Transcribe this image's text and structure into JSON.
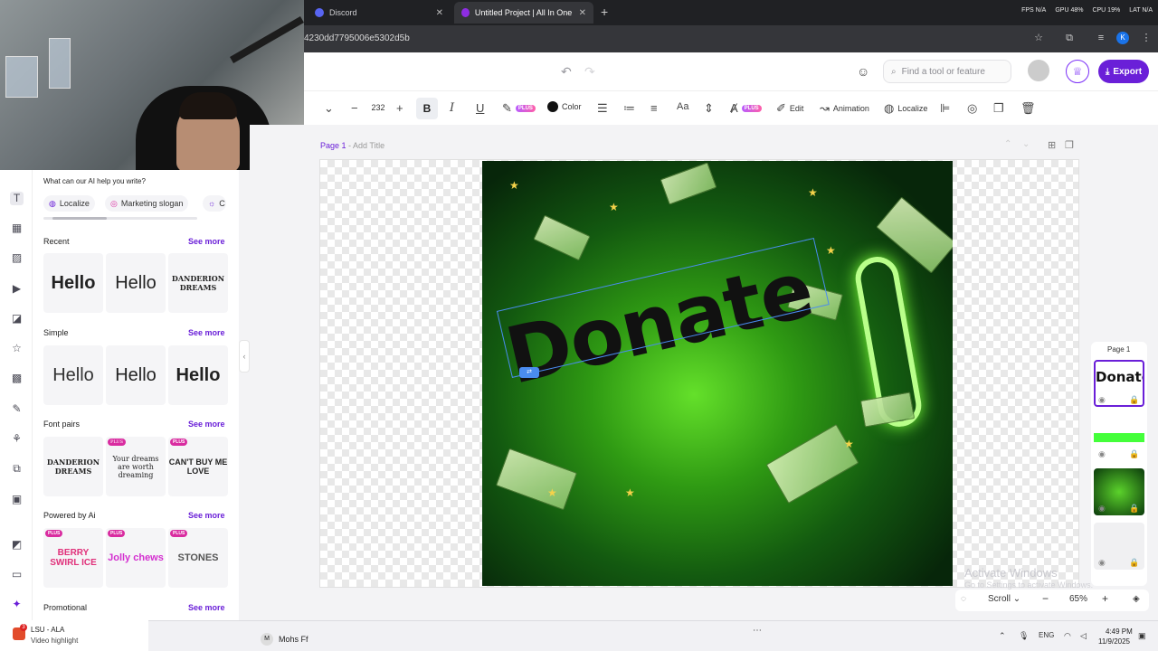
{
  "browser": {
    "tabs": [
      {
        "label": "Discord",
        "color": "#5865f2"
      },
      {
        "label": "Untitled Project | All In One We",
        "color": "#8e2de2"
      }
    ],
    "perf": [
      "FPS N/A",
      "GPU 48%",
      "CPU 19%",
      "LAT N/A"
    ],
    "url": "4230dd7795006e5302d5b",
    "profile_initial": "K"
  },
  "header": {
    "search_placeholder": "Find a tool or feature",
    "export_label": "Export"
  },
  "toolbar": {
    "font_size": "232",
    "color_label": "Color",
    "edit_label": "Edit",
    "animation_label": "Animation",
    "localize_label": "Localize",
    "plus_badge": "PLUS"
  },
  "panel": {
    "ai_prompt": "What can our AI help you write?",
    "chips": [
      "Localize",
      "Marketing slogan",
      "C"
    ],
    "sections": [
      {
        "title": "Recent",
        "see_more": "See more"
      },
      {
        "title": "Simple",
        "see_more": "See more"
      },
      {
        "title": "Font pairs",
        "see_more": "See more"
      },
      {
        "title": "Powered by Ai",
        "see_more": "See more"
      },
      {
        "title": "Promotional",
        "see_more": "See more"
      }
    ],
    "recent_tiles": [
      "Hello",
      "Hello",
      "DANDERION DREAMS"
    ],
    "simple_tiles": [
      "Hello",
      "Hello",
      "Hello"
    ],
    "font_pair_tiles": [
      "DANDERION DREAMS",
      "Your dreams are worth dreaming",
      "CAN'T BUY ME LOVE"
    ],
    "ai_tiles": [
      "BERRY SWIRL ICE",
      "Jolly chews",
      "STONES"
    ]
  },
  "canvas": {
    "page_label": "Page 1",
    "page_title_placeholder": "- Add Title",
    "text": "Donate",
    "watermark_title": "Activate Windows",
    "watermark_sub": "Go to Settings to activate Windows.",
    "scroll_label": "Scroll",
    "zoom": "65%"
  },
  "layers": {
    "title": "Page 1",
    "first_layer_text": "Donate"
  },
  "taskbar": {
    "news_title": "LSU - ALA",
    "news_sub": "Video highlight",
    "news_badge": "3",
    "chat_name": "Mohs Ff",
    "chat_initial": "M",
    "lang": "ENG",
    "time": "4:49 PM",
    "date": "11/9/2025"
  }
}
